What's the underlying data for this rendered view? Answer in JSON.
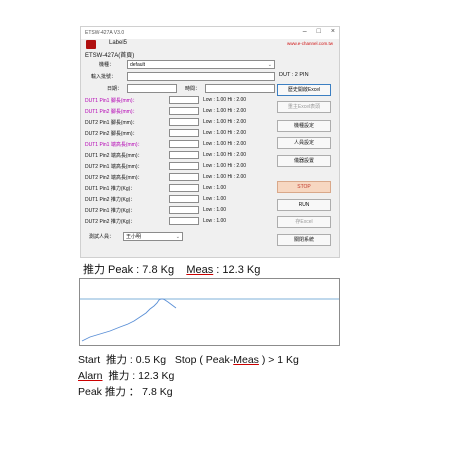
{
  "window": {
    "app_name": "ETSW-427A V3.0",
    "controls": [
      "–",
      "□",
      "×"
    ],
    "label5": "Label5",
    "url": "www.e-channel.com.tw",
    "subtitle": "ETSW-427A(首頁)"
  },
  "form": {
    "machine_label": "機種：",
    "machine_value": "default",
    "input_label": "輸入批號：",
    "input_value": "",
    "date_label": "日期：",
    "date_value": "",
    "time_label": "時間：",
    "time_value": "",
    "tester_label": "測試人員：",
    "tester_value": "王小明"
  },
  "dut_rows": [
    {
      "label": "DUT1  Pin1 腳長(mm)：",
      "limits": "Low : 1.00  Hi : 2.00",
      "highlight": true
    },
    {
      "label": "DUT1  Pin2 腳長(mm)：",
      "limits": "Low : 1.00  Hi : 2.00",
      "highlight": true
    },
    {
      "label": "DUT2  Pin1 腳長(mm)：",
      "limits": "Low : 1.00  Hi : 2.00",
      "highlight": false
    },
    {
      "label": "DUT2  Pin2 腳長(mm)：",
      "limits": "Low : 1.00  Hi : 2.00",
      "highlight": false
    },
    {
      "label": "DUT1  Pin1 端高長(mm)：",
      "limits": "Low : 1.00  Hi : 2.00",
      "highlight": true
    },
    {
      "label": "DUT1  Pin2 端高長(mm)：",
      "limits": "Low : 1.00  Hi : 2.00",
      "highlight": false
    },
    {
      "label": "DUT2  Pin1 端高長(mm)：",
      "limits": "Low : 1.00  Hi : 2.00",
      "highlight": false
    },
    {
      "label": "DUT2  Pin2 端高長(mm)：",
      "limits": "Low : 1.00  Hi : 2.00",
      "highlight": false
    },
    {
      "label": "DUT1  Pin1 推力(Kg)：",
      "limits": "Low : 1.00",
      "highlight": false
    },
    {
      "label": "DUT1  Pin2 推力(Kg)：",
      "limits": "Low : 1.00",
      "highlight": false
    },
    {
      "label": "DUT2  Pin1 推力(Kg)：",
      "limits": "Low : 1.00",
      "highlight": false
    },
    {
      "label": "DUT2  Pin2 推力(Kg)：",
      "limits": "Low : 1.00",
      "highlight": false
    }
  ],
  "side": {
    "dut_pin": "DUT : 2 PIN",
    "buttons": [
      {
        "label": "歷史開啟Excel",
        "style": "primary"
      },
      {
        "label": "重主Excel表頭",
        "style": "dim"
      },
      {
        "label": "機種設定",
        "style": "normal"
      },
      {
        "label": "人員設定",
        "style": "normal"
      },
      {
        "label": "儀器設置",
        "style": "normal"
      },
      {
        "label": "STOP",
        "style": "stop"
      },
      {
        "label": "RUN",
        "style": "normal"
      },
      {
        "label": "存Excel",
        "style": "dim"
      },
      {
        "label": "關閉系統",
        "style": "normal"
      }
    ]
  },
  "notes": {
    "line_peak_prefix": "推力 Peak : 7.8 Kg    ",
    "line_peak_meas": "Meas",
    "line_peak_suffix": " : 12.3 Kg",
    "start_prefix": "Start  推力 : 0.5 Kg   Stop ( Peak-",
    "start_meas": "Meas",
    "start_suffix": " ) > 1 Kg",
    "alarm_word": "Alarn",
    "alarm_rest": "  推力 : 12.3 Kg",
    "peak_line": "Peak  推力 ： 7.8 Kg"
  },
  "colors": {
    "magenta": "#b400b4",
    "stop_bg": "#f7d7c1",
    "stop_text": "#c0392b",
    "url": "#d01010",
    "curve": "#5a8fd6",
    "threshold": "#7fb0d8"
  }
}
